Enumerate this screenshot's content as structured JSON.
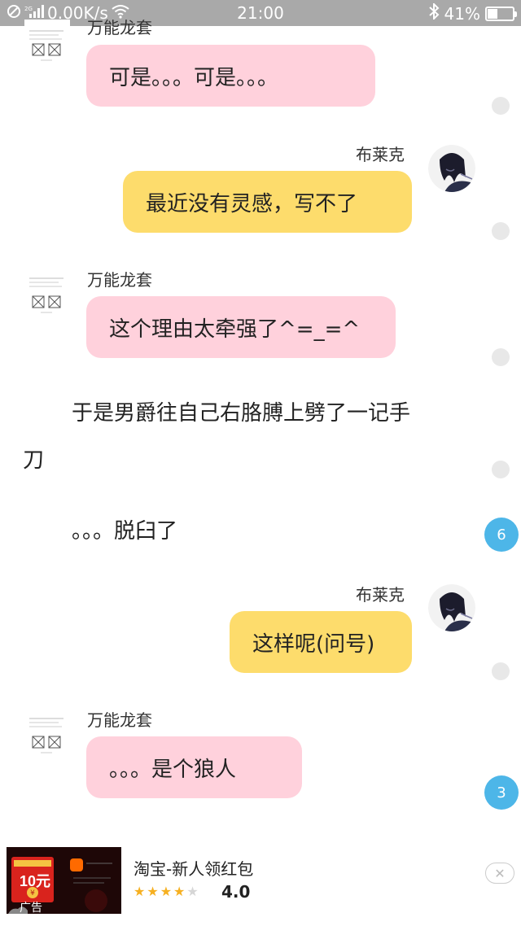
{
  "status_bar": {
    "network": "2G",
    "speed": "0.00K/s",
    "time": "21:00",
    "battery": "41%",
    "battery_level": 0.41
  },
  "messages": {
    "m1": {
      "sender": "万能龙套",
      "text": "可是。。。可是。。。"
    },
    "m2": {
      "sender": "布莱克",
      "text": "最近没有灵感，写不了"
    },
    "m3": {
      "sender": "万能龙套",
      "text": "这个理由太牵强了^=_=^"
    },
    "narration1_line1": "于是男爵往自己右胳膊上劈了一记手",
    "narration1_line2": "刀",
    "narration2": "。。。脱臼了",
    "m4": {
      "sender": "布莱克",
      "text": "这样呢(问号)"
    },
    "m5": {
      "sender": "万能龙套",
      "text": "。。。是个狼人"
    }
  },
  "badges": {
    "b1": "6",
    "b2": "3"
  },
  "ad": {
    "title": "淘宝-新人领红包",
    "rating": "4.0",
    "stars": 4,
    "label": "广告",
    "image_text": "10元"
  },
  "colors": {
    "pink_bubble": "#ffd1dc",
    "yellow_bubble": "#fddc6c",
    "badge": "#4db6e8",
    "status_bar": "#a9a9a9"
  }
}
